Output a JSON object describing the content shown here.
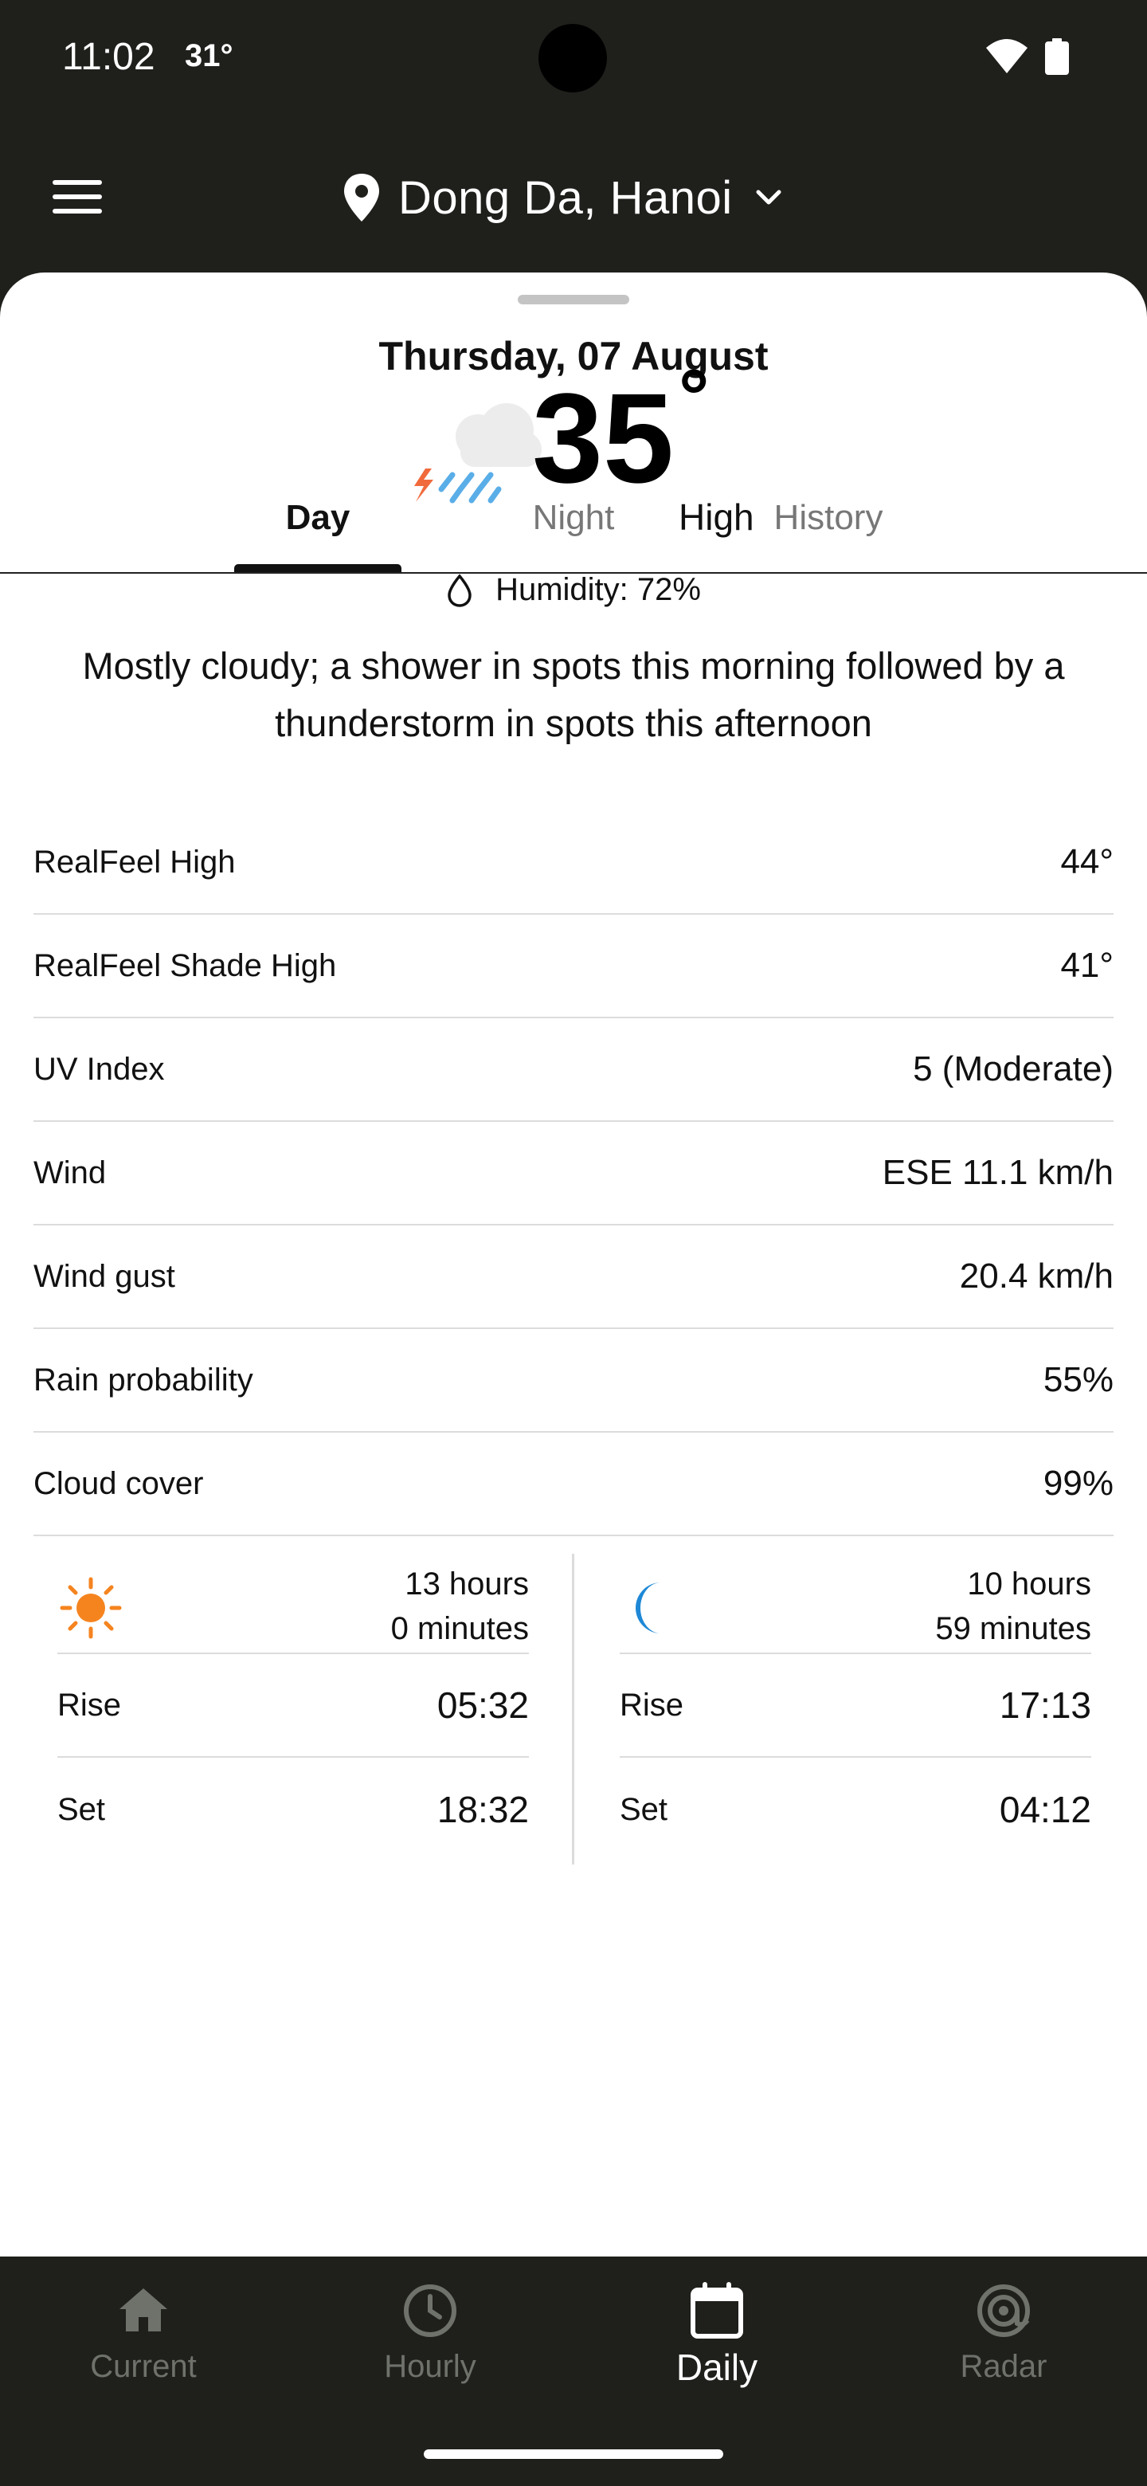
{
  "status_bar": {
    "time": "11:02",
    "temp": "31°"
  },
  "header": {
    "location": "Dong Da, Hanoi"
  },
  "sheet": {
    "date_title": "Thursday, 07 August",
    "tabs": [
      {
        "label": "Day",
        "active": true
      },
      {
        "label": "Night",
        "active": false
      },
      {
        "label": "History",
        "active": false
      }
    ]
  },
  "hero": {
    "temperature": "35",
    "degree": "°",
    "temp_label": "High",
    "humidity": "Humidity: 72%",
    "description": "Mostly cloudy; a shower in spots this morning followed by a thunderstorm in spots this afternoon",
    "weather_icon": "cloud-thunderstorm-rain-icon"
  },
  "details": [
    {
      "label": "RealFeel High",
      "value": "44°"
    },
    {
      "label": "RealFeel Shade High",
      "value": "41°"
    },
    {
      "label": "UV Index",
      "value": "5 (Moderate)"
    },
    {
      "label": "Wind",
      "value": "ESE 11.1 km/h"
    },
    {
      "label": "Wind gust",
      "value": "20.4 km/h"
    },
    {
      "label": "Rain probability",
      "value": "55%"
    },
    {
      "label": "Cloud cover",
      "value": "99%"
    }
  ],
  "sun": {
    "icon": "sun-icon",
    "duration_line1": "13 hours",
    "duration_line2": "0 minutes",
    "rise_label": "Rise",
    "rise": "05:32",
    "set_label": "Set",
    "set": "18:32"
  },
  "moon": {
    "icon": "moon-icon",
    "duration_line1": "10 hours",
    "duration_line2": "59 minutes",
    "rise_label": "Rise",
    "rise": "17:13",
    "set_label": "Set",
    "set": "04:12"
  },
  "bottom_nav": [
    {
      "label": "Current",
      "icon": "home-icon",
      "active": false
    },
    {
      "label": "Hourly",
      "icon": "clock-icon",
      "active": false
    },
    {
      "label": "Daily",
      "icon": "calendar-icon",
      "active": true
    },
    {
      "label": "Radar",
      "icon": "radar-icon",
      "active": false
    }
  ],
  "colors": {
    "dark_bg": "#1f201c",
    "sun": "#f5841f",
    "moon": "#1e88d6",
    "rain": "#5aaee8",
    "lightning": "#f06a3c"
  }
}
